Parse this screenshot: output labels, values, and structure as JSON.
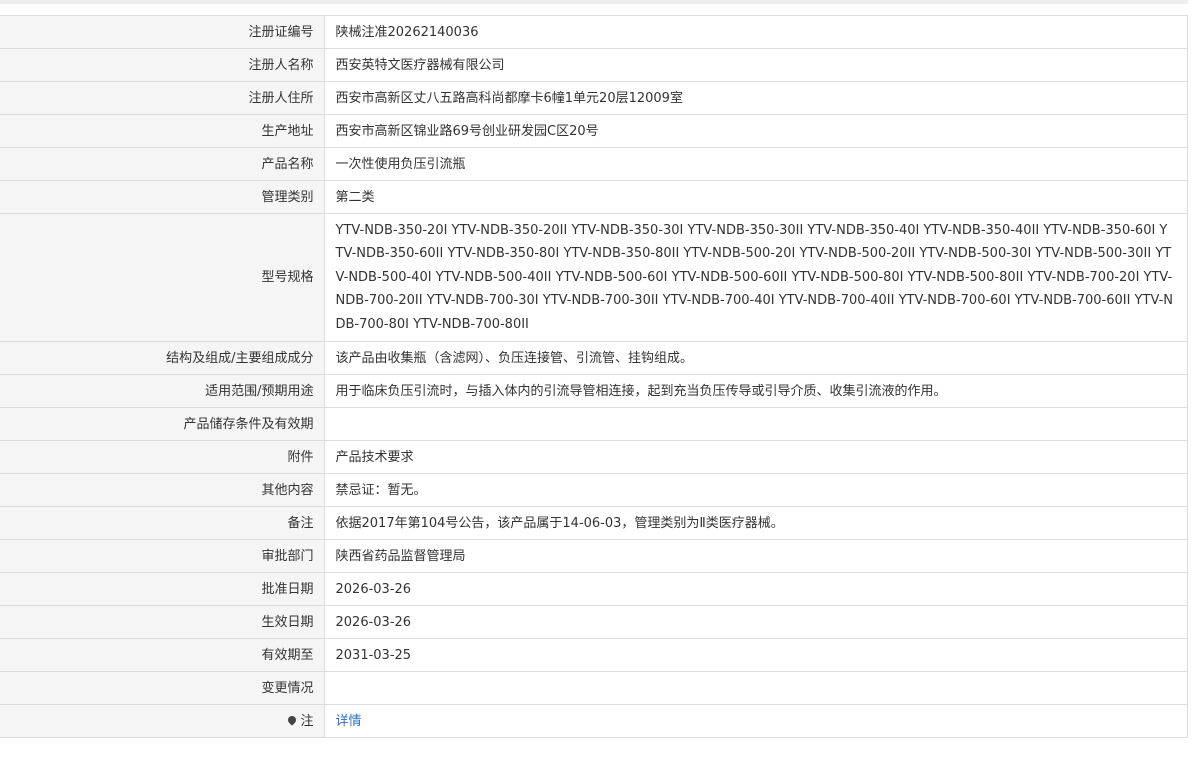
{
  "rows": [
    {
      "label": "注册证编号",
      "value": "陕械注准20262140036"
    },
    {
      "label": "注册人名称",
      "value": "西安英特文医疗器械有限公司"
    },
    {
      "label": "注册人住所",
      "value": "西安市高新区丈八五路高科尚都摩卡6幢1单元20层12009室"
    },
    {
      "label": "生产地址",
      "value": "西安市高新区锦业路69号创业研发园C区20号"
    },
    {
      "label": "产品名称",
      "value": "一次性使用负压引流瓶"
    },
    {
      "label": "管理类别",
      "value": "第二类"
    },
    {
      "label": "型号规格",
      "value": "YTV-NDB-350-20I YTV-NDB-350-20II YTV-NDB-350-30I YTV-NDB-350-30II YTV-NDB-350-40I YTV-NDB-350-40II YTV-NDB-350-60I YTV-NDB-350-60II YTV-NDB-350-80I YTV-NDB-350-80II YTV-NDB-500-20I YTV-NDB-500-20II YTV-NDB-500-30I YTV-NDB-500-30II YTV-NDB-500-40I YTV-NDB-500-40II YTV-NDB-500-60I YTV-NDB-500-60II YTV-NDB-500-80I YTV-NDB-500-80II YTV-NDB-700-20I YTV-NDB-700-20II YTV-NDB-700-30I YTV-NDB-700-30II YTV-NDB-700-40I YTV-NDB-700-40II YTV-NDB-700-60I YTV-NDB-700-60II YTV-NDB-700-80I YTV-NDB-700-80II"
    },
    {
      "label": "结构及组成/主要组成成分",
      "value": "该产品由收集瓶（含滤网）、负压连接管、引流管、挂钩组成。"
    },
    {
      "label": "适用范围/预期用途",
      "value": "用于临床负压引流时，与插入体内的引流导管相连接，起到充当负压传导或引导介质、收集引流液的作用。"
    },
    {
      "label": "产品储存条件及有效期",
      "value": ""
    },
    {
      "label": "附件",
      "value": "产品技术要求"
    },
    {
      "label": "其他内容",
      "value": "禁忌证：暂无。"
    },
    {
      "label": "备注",
      "value": "依据2017年第104号公告，该产品属于14-06-03，管理类别为Ⅱ类医疗器械。"
    },
    {
      "label": "审批部门",
      "value": "陕西省药品监督管理局"
    },
    {
      "label": "批准日期",
      "value": "2026-03-26"
    },
    {
      "label": "生效日期",
      "value": "2026-03-26"
    },
    {
      "label": "有效期至",
      "value": "2031-03-25"
    },
    {
      "label": "变更情况",
      "value": ""
    }
  ],
  "note_row": {
    "label": "注",
    "icon": "pin-icon",
    "link_text": "详情"
  },
  "colors": {
    "label_bg": "#f5f5f5",
    "border": "#dddddd",
    "link": "#2a6fc9"
  }
}
